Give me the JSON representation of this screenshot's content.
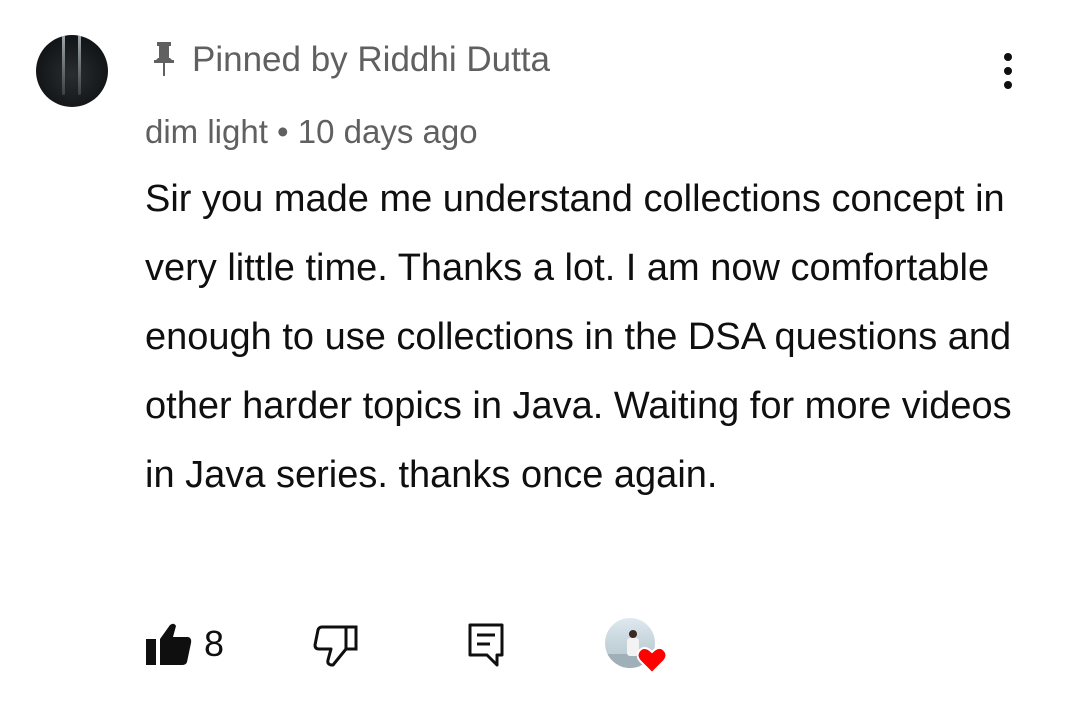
{
  "pinned": {
    "icon": "pin-icon",
    "text": "Pinned by Riddhi Dutta"
  },
  "comment": {
    "author": "dim light",
    "separator": " • ",
    "time_ago": "10 days ago",
    "text": "Sir you made me understand collections concept in very little time. Thanks a lot. I am now comfortable enough to use collections in the DSA questions and other harder topics in Java. Waiting for more videos in Java series. thanks once again."
  },
  "menu": {
    "icon": "more-vertical-icon"
  },
  "actions": {
    "like_icon": "thumbs-up-icon",
    "like_count": "8",
    "dislike_icon": "thumbs-down-icon",
    "reply_icon": "reply-comment-icon",
    "heart_icon": "heart-icon"
  },
  "colors": {
    "secondary_text": "#606060",
    "primary_text": "#0f0f0f",
    "heart": "#ff0000",
    "background": "#ffffff"
  }
}
